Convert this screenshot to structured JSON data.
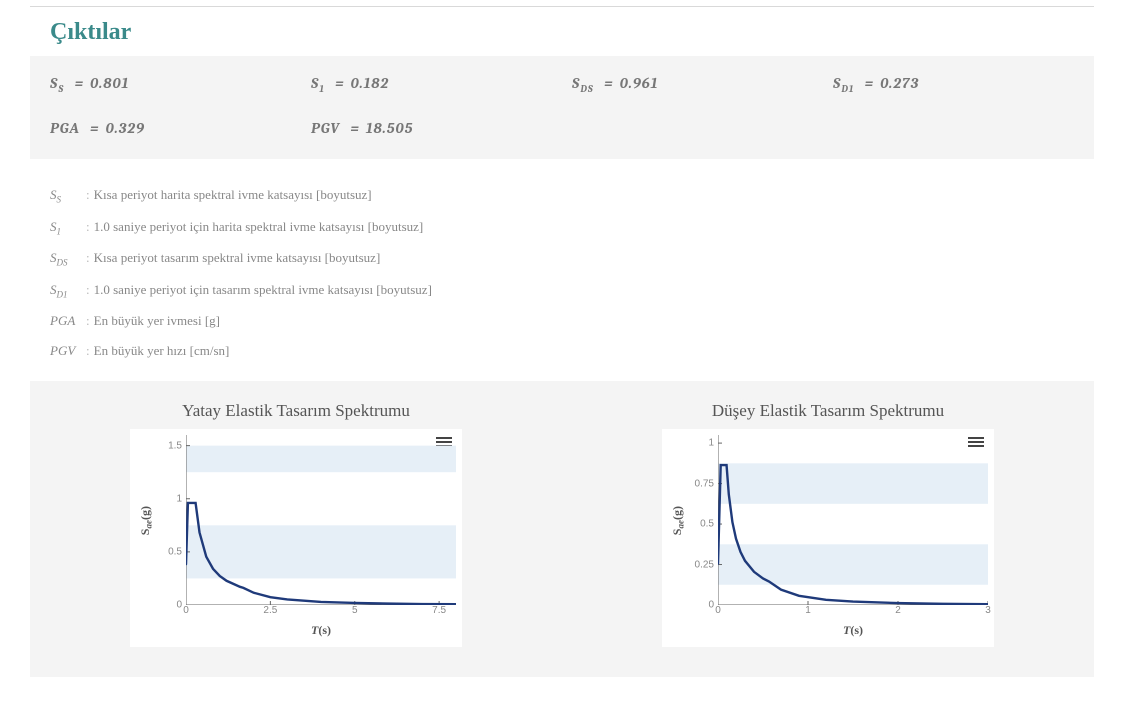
{
  "section_title": "Çıktılar",
  "outputs": {
    "ss_label": "S",
    "ss_sub": "S",
    "ss_eq": "=",
    "ss_val": "0.801",
    "s1_label": "S",
    "s1_sub": "1",
    "s1_eq": "=",
    "s1_val": "0.182",
    "sds_label": "S",
    "sds_sub": "DS",
    "sds_eq": "=",
    "sds_val": "0.961",
    "sd1_label": "S",
    "sd1_sub": "D1",
    "sd1_eq": "=",
    "sd1_val": "0.273",
    "pga_label": "PGA",
    "pga_eq": "=",
    "pga_val": "0.329",
    "pgv_label": "PGV",
    "pgv_eq": "=",
    "pgv_val": "18.505"
  },
  "definitions": [
    {
      "sym": "S",
      "sub": "S",
      "text": "Kısa periyot harita spektral ivme katsayısı [boyutsuz]"
    },
    {
      "sym": "S",
      "sub": "1",
      "text": "1.0 saniye periyot için harita spektral ivme katsayısı [boyutsuz]"
    },
    {
      "sym": "S",
      "sub": "DS",
      "text": "Kısa periyot tasarım spektral ivme katsayısı [boyutsuz]"
    },
    {
      "sym": "S",
      "sub": "D1",
      "text": "1.0 saniye periyot için tasarım spektral ivme katsayısı [boyutsuz]"
    },
    {
      "sym": "PGA",
      "sub": "",
      "text": "En büyük yer ivmesi [g]"
    },
    {
      "sym": "PGV",
      "sub": "",
      "text": "En büyük yer hızı [cm/sn]"
    }
  ],
  "chart_data": [
    {
      "type": "line",
      "title": "Yatay Elastik Tasarım Spektrumu",
      "xlabel": "T(s)",
      "ylabel": "Sae(g)",
      "xlim": [
        0,
        8
      ],
      "ylim": [
        0,
        1.6
      ],
      "xticks": [
        0,
        2.5,
        5,
        7.5
      ],
      "yticks": [
        0,
        0.5,
        1,
        1.5
      ],
      "x": [
        0.0,
        0.05,
        0.057,
        0.1,
        0.2,
        0.284,
        0.4,
        0.6,
        0.8,
        1.0,
        1.2,
        1.6,
        1.7,
        2.0,
        2.5,
        3.0,
        4.0,
        5.0,
        6.0,
        7.0,
        8.0
      ],
      "y": [
        0.384,
        0.89,
        0.961,
        0.961,
        0.961,
        0.961,
        0.683,
        0.455,
        0.341,
        0.273,
        0.228,
        0.171,
        0.161,
        0.116,
        0.074,
        0.052,
        0.029,
        0.019,
        0.013,
        0.009,
        0.007
      ],
      "bands_y": [
        [
          0.25,
          0.75
        ],
        [
          1.25,
          1.5
        ]
      ]
    },
    {
      "type": "line",
      "title": "Düşey Elastik Tasarım Spektrumu",
      "xlabel": "T(s)",
      "ylabel": "Sae(g)",
      "xlim": [
        0,
        3
      ],
      "ylim": [
        0,
        1.05
      ],
      "xticks": [
        0,
        1,
        2,
        3
      ],
      "yticks": [
        0,
        0.25,
        0.5,
        0.75,
        1
      ],
      "x": [
        0.0,
        0.019,
        0.03,
        0.05,
        0.095,
        0.12,
        0.16,
        0.2,
        0.25,
        0.3,
        0.4,
        0.5,
        0.567,
        0.7,
        0.9,
        1.2,
        1.5,
        2.0,
        2.5,
        3.0
      ],
      "y": [
        0.256,
        0.641,
        0.864,
        0.864,
        0.864,
        0.683,
        0.512,
        0.41,
        0.328,
        0.273,
        0.205,
        0.164,
        0.145,
        0.095,
        0.057,
        0.032,
        0.021,
        0.012,
        0.007,
        0.005
      ],
      "bands_y": [
        [
          0.125,
          0.375
        ],
        [
          0.625,
          0.875
        ]
      ]
    }
  ]
}
